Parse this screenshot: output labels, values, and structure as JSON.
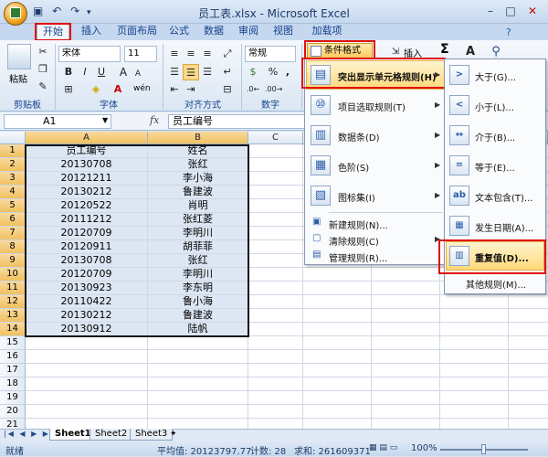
{
  "app": {
    "title": "员工表.xlsx - Microsoft Excel",
    "qat_icons": [
      "save-icon",
      "undo-icon",
      "redo-icon"
    ]
  },
  "tabs": [
    "开始",
    "插入",
    "页面布局",
    "公式",
    "数据",
    "审阅",
    "视图",
    "加载项"
  ],
  "ribbon": {
    "paste_label": "粘贴",
    "font_name": "宋体",
    "font_size": "11",
    "bold": "B",
    "italic": "I",
    "underline": "U",
    "font_size_up": "A",
    "font_size_down": "A",
    "wen": "wén",
    "number_format": "常规",
    "percent": "%",
    "comma": ",",
    "cond_format": "条件格式",
    "insert": "插入",
    "sigma": "Σ",
    "groups": {
      "clipboard": "剪贴板",
      "font": "字体",
      "align": "对齐方式",
      "number": "数字"
    }
  },
  "formula_bar": {
    "cell_ref": "A1",
    "fx": "fx",
    "value": "员工编号"
  },
  "columns": [
    "A",
    "B",
    "C"
  ],
  "rows": [
    [
      "员工编号",
      "姓名"
    ],
    [
      "20130708",
      "张红"
    ],
    [
      "20121211",
      "李小海"
    ],
    [
      "20130212",
      "鲁建波"
    ],
    [
      "20120522",
      "肖明"
    ],
    [
      "20111212",
      "张红菱"
    ],
    [
      "20120709",
      "李明川"
    ],
    [
      "20120911",
      "胡菲菲"
    ],
    [
      "20130708",
      "张红"
    ],
    [
      "20120709",
      "李明川"
    ],
    [
      "20130923",
      "李东明"
    ],
    [
      "20110422",
      "鲁小海"
    ],
    [
      "20130212",
      "鲁建波"
    ],
    [
      "20130912",
      "陆帆"
    ]
  ],
  "row_numbers": [
    "1",
    "2",
    "3",
    "4",
    "5",
    "6",
    "7",
    "8",
    "9",
    "10",
    "11",
    "12",
    "13",
    "14",
    "15",
    "16",
    "17",
    "18",
    "19",
    "20",
    "21"
  ],
  "sheets": [
    "Sheet1",
    "Sheet2",
    "Sheet3"
  ],
  "status": {
    "ready": "就绪",
    "average": "平均值: 20123797.77",
    "count": "计数: 28",
    "sum": "求和: 261609371",
    "zoom": "100%"
  },
  "cond_menu": {
    "items": [
      {
        "label": "突出显示单元格规则(H)",
        "icon": "highlight-rules-icon"
      },
      {
        "label": "项目选取规则(T)",
        "icon": "top-bottom-rules-icon"
      },
      {
        "label": "数据条(D)",
        "icon": "data-bars-icon"
      },
      {
        "label": "色阶(S)",
        "icon": "color-scales-icon"
      },
      {
        "label": "图标集(I)",
        "icon": "icon-sets-icon"
      }
    ],
    "small_items": [
      "新建规则(N)...",
      "清除规则(C)",
      "管理规则(R)..."
    ]
  },
  "sub_menu": {
    "items": [
      "大于(G)...",
      "小于(L)...",
      "介于(B)...",
      "等于(E)...",
      "文本包含(T)...",
      "发生日期(A)...",
      "重复值(D)..."
    ],
    "more": "其他规则(M)..."
  },
  "colors": {
    "ribbon_text": "#15428b",
    "highlight": "#e01010",
    "selection": "#dde6f3"
  }
}
